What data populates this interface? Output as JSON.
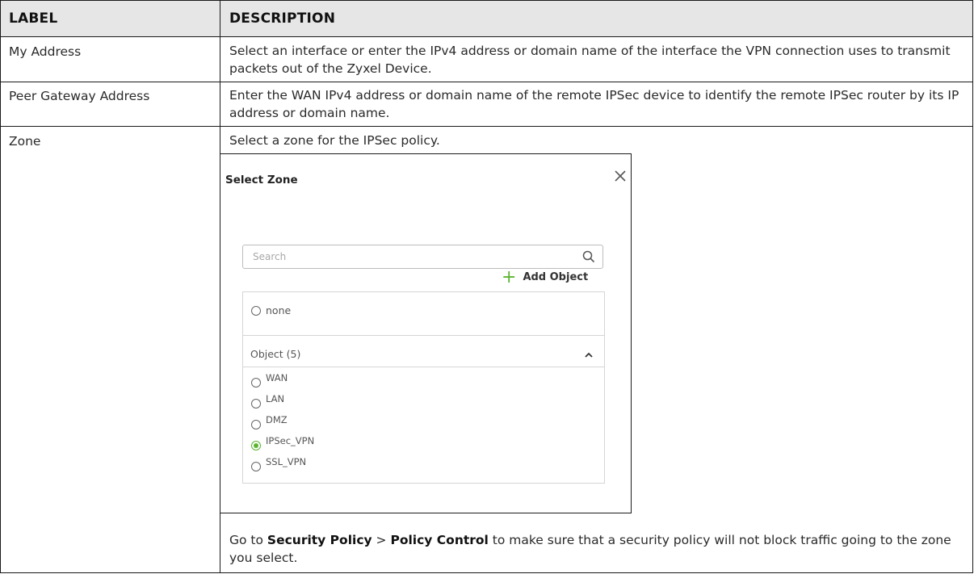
{
  "table": {
    "headers": {
      "label": "LABEL",
      "description": "DESCRIPTION"
    },
    "rows": [
      {
        "label": "My Address",
        "description": "Select an interface or enter the IPv4 address or domain name of the interface the VPN connection uses to transmit packets out of  the Zyxel Device."
      },
      {
        "label": "Peer Gateway Address",
        "description": "Enter the WAN IPv4 address or domain name of the remote IPSec device to identify the remote IPSec router by its IP address or domain name."
      },
      {
        "label": "Zone",
        "description": "Select a zone for the IPSec policy.",
        "note_prefix": "Go to ",
        "note_link1": "Security Policy",
        "note_sep": " > ",
        "note_link2": "Policy Control",
        "note_suffix": " to make sure that a security policy will not block traffic going to the zone you select."
      }
    ]
  },
  "dialog": {
    "title": "Select Zone",
    "close_icon": "close-icon",
    "search": {
      "placeholder": "Search",
      "value": "",
      "icon": "search-icon"
    },
    "add_object": {
      "label": "Add Object",
      "icon": "plus-icon",
      "icon_color": "#5cb531"
    },
    "none_option": {
      "label": "none",
      "checked": false
    },
    "group": {
      "label": "Object (5)",
      "expanded": true,
      "icon": "chevron-up-icon",
      "items": [
        {
          "label": "WAN",
          "checked": false
        },
        {
          "label": "LAN",
          "checked": false
        },
        {
          "label": "DMZ",
          "checked": false
        },
        {
          "label": "IPSec_VPN",
          "checked": true
        },
        {
          "label": "SSL_VPN",
          "checked": false
        }
      ]
    }
  },
  "colors": {
    "header_bg": "#e6e6e6",
    "accent_green": "#5cb531",
    "border": "#1a1a1a"
  }
}
